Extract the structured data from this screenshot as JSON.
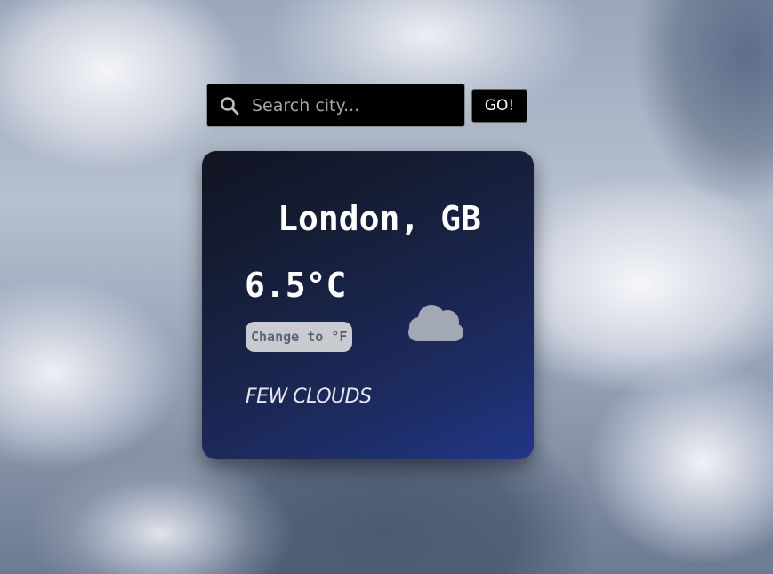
{
  "search": {
    "placeholder": "Search city...",
    "value": "",
    "icon": "search-icon",
    "go_label": "GO!"
  },
  "weather": {
    "city": "London, GB",
    "temperature": "6.5°C",
    "unit_toggle_label": "Change to °F",
    "description": "FEW CLOUDS",
    "icon": "few-clouds-night-icon"
  },
  "colors": {
    "card_gradient_start": "#111420",
    "card_gradient_end": "#223687",
    "icon_color": "#a3a8b6",
    "toggle_bg": "#c9cbd1",
    "toggle_text": "#5d6273"
  }
}
